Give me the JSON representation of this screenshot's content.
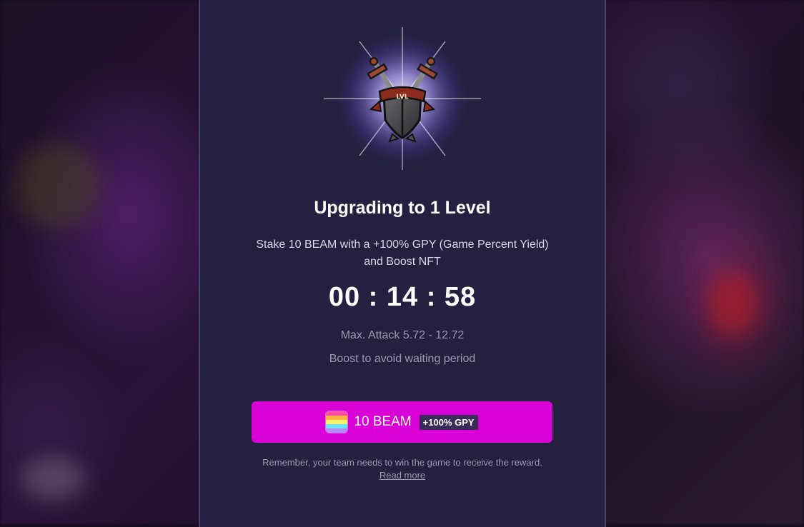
{
  "upgrade": {
    "title": "Upgrading to 1 Level",
    "description": "Stake 10 BEAM with a +100% GPY (Game Percent Yield) and Boost NFT",
    "timer": "00 : 14 : 58",
    "max_attack": "Max. Attack 5.72 - 12.72",
    "boost_hint": "Boost to avoid waiting period",
    "emblem_text": "LVL"
  },
  "stake_button": {
    "label": "10 BEAM",
    "badge": "+100% GPY",
    "icon": "beam-token-icon",
    "color": "#d800d4"
  },
  "footer": {
    "note": "Remember, your team needs to win the game to receive the reward.",
    "link": "Read more"
  },
  "colors": {
    "panel_bg": "#23213f",
    "accent": "#d800d4",
    "muted_text": "#9b98b4"
  }
}
